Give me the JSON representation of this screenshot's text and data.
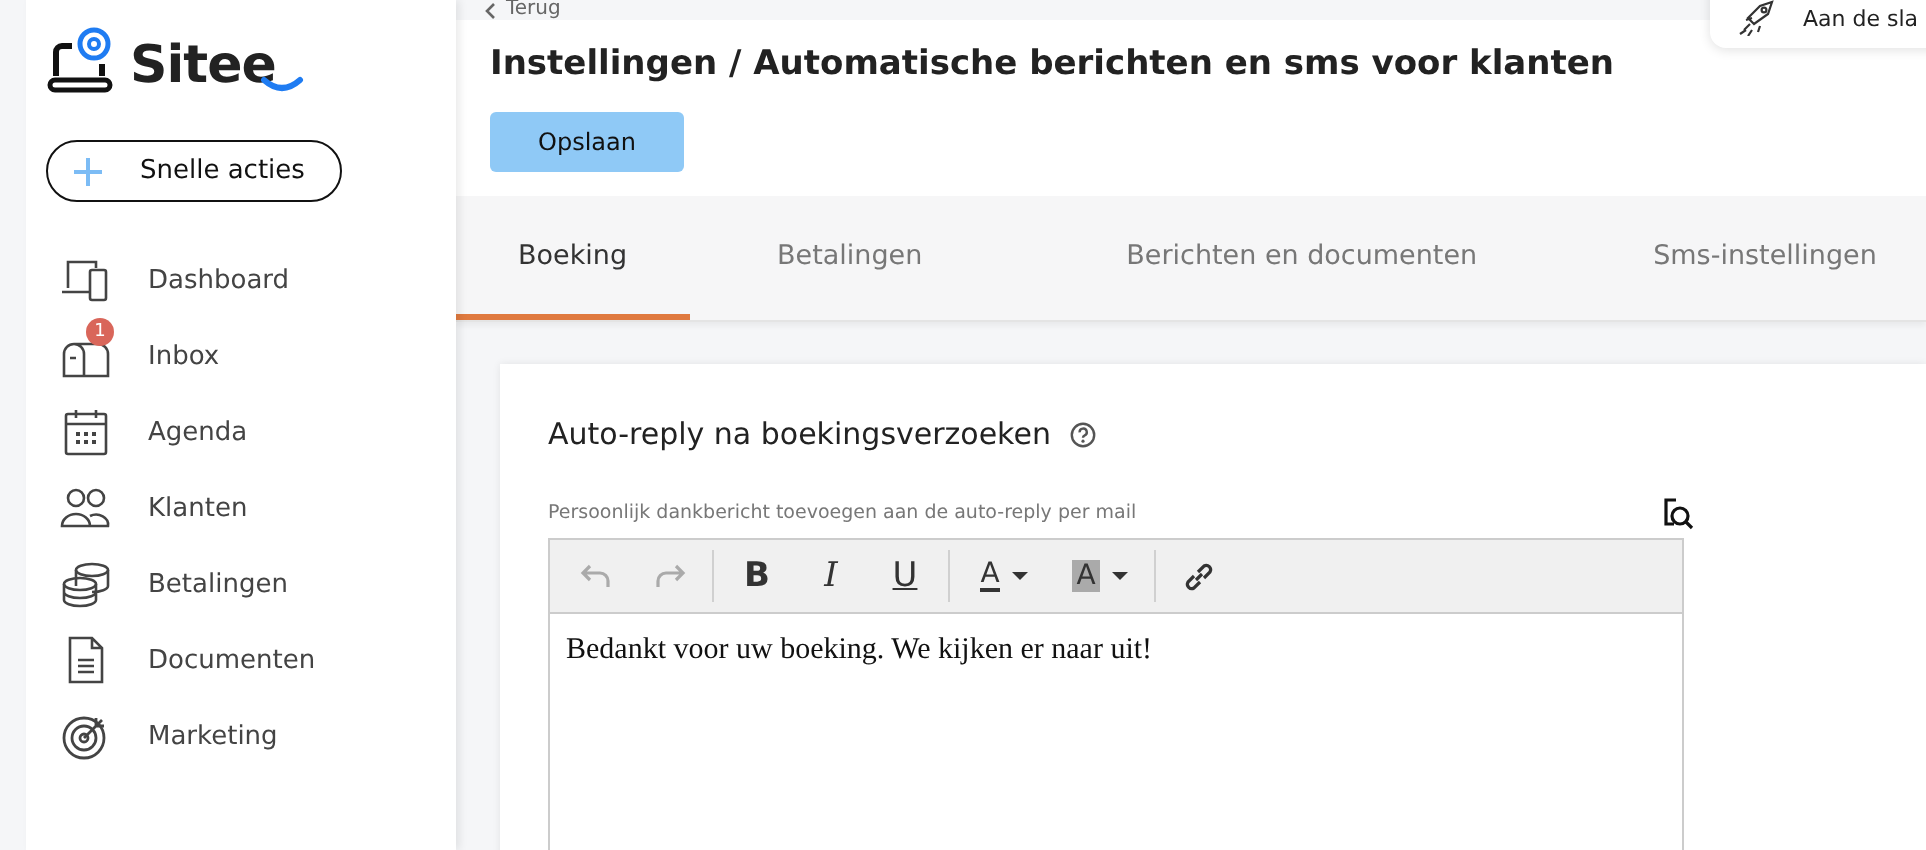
{
  "sidebar": {
    "logo": "Sitee",
    "quick_action": "Snelle acties",
    "items": [
      {
        "kind": "devices",
        "label": "Dashboard"
      },
      {
        "kind": "mailbox",
        "label": "Inbox",
        "badge": "1"
      },
      {
        "kind": "calendar",
        "label": "Agenda"
      },
      {
        "kind": "people",
        "label": "Klanten"
      },
      {
        "kind": "coins",
        "label": "Betalingen"
      },
      {
        "kind": "document",
        "label": "Documenten"
      },
      {
        "kind": "target",
        "label": "Marketing"
      }
    ]
  },
  "back_link": "Terug",
  "popup": {
    "label": "Aan de sla"
  },
  "title": "Instellingen / Automatische berichten en sms voor klanten",
  "save_button": "Opslaan",
  "tabs": [
    {
      "label": "Boeking",
      "selected": true
    },
    {
      "label": "Betalingen",
      "selected": false
    },
    {
      "label": "Berichten en documenten",
      "selected": false
    },
    {
      "label": "Sms-instellingen",
      "selected": false
    }
  ],
  "section": {
    "title": "Auto-reply na boekingsverzoeken",
    "field_label": "Persoonlijk dankbericht toevoegen aan de auto-reply per mail",
    "toolbar": [
      {
        "kind": "undo",
        "disabled": true
      },
      {
        "kind": "redo",
        "disabled": true
      },
      {
        "kind": "bold",
        "label": "B"
      },
      {
        "kind": "italic",
        "label": "I"
      },
      {
        "kind": "underline",
        "label": "U"
      },
      {
        "kind": "color",
        "label": "A"
      },
      {
        "kind": "highlight",
        "label": "A"
      },
      {
        "kind": "link"
      }
    ],
    "body": "Bedankt voor uw boeking. We kijken er naar uit!"
  }
}
